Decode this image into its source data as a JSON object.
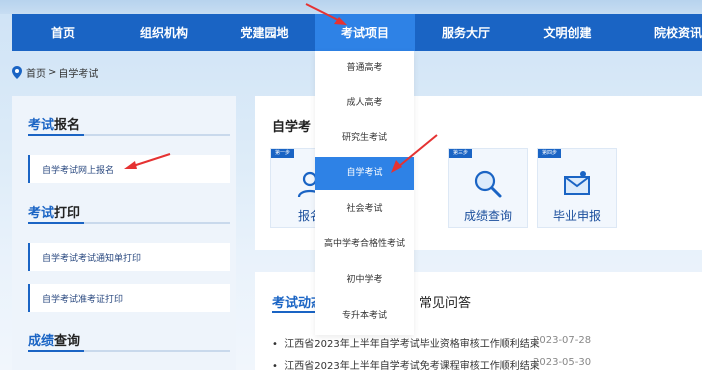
{
  "nav": {
    "items": [
      {
        "label": "首页"
      },
      {
        "label": "组织机构"
      },
      {
        "label": "党建园地"
      },
      {
        "label": "考试项目"
      },
      {
        "label": "服务大厅"
      },
      {
        "label": "文明创建"
      },
      {
        "label": "院校资讯"
      }
    ],
    "active_index": 3
  },
  "breadcrumb": {
    "home": "首页",
    "sep": ">",
    "current": "自学考试",
    "icon": "location-pin-icon"
  },
  "sidebar": {
    "sections": [
      {
        "title_hl": "考试",
        "title_rest": "报名",
        "links": [
          "自学考试网上报名"
        ]
      },
      {
        "title_hl": "考试",
        "title_rest": "打印",
        "links": [
          "自学考试考试通知单打印",
          "自学考试准考证打印"
        ]
      },
      {
        "title_hl": "成绩",
        "title_rest": "查询",
        "links": []
      }
    ]
  },
  "self_exam_panel": {
    "title": "自学考",
    "steps": [
      {
        "badge": "第一步",
        "label": "报名",
        "icon": "user-icon"
      },
      {
        "badge": "第三步",
        "label": "成绩查询",
        "icon": "magnifier-icon"
      },
      {
        "badge": "第四步",
        "label": "毕业申报",
        "icon": "certificate-icon"
      }
    ]
  },
  "news_panel": {
    "tab_active": "考试动态",
    "tab_other": "常见问答",
    "items": [
      {
        "title": "江西省2023年上半年自学考试毕业资格审核工作顺利结束",
        "date": "2023-07-28"
      },
      {
        "title": "江西省2023年上半年自学考试免考课程审核工作顺利结束",
        "date": "2023-05-30"
      }
    ]
  },
  "dropdown": {
    "items": [
      "普通高考",
      "成人高考",
      "研究生考试",
      "自学考试",
      "社会考试",
      "高中学考合格性考试",
      "初中学考",
      "专升本考试"
    ],
    "active_index": 3
  },
  "colors": {
    "primary": "#1a64c4",
    "nav_active": "#2e82e6",
    "annotation_arrow": "#e53232"
  }
}
